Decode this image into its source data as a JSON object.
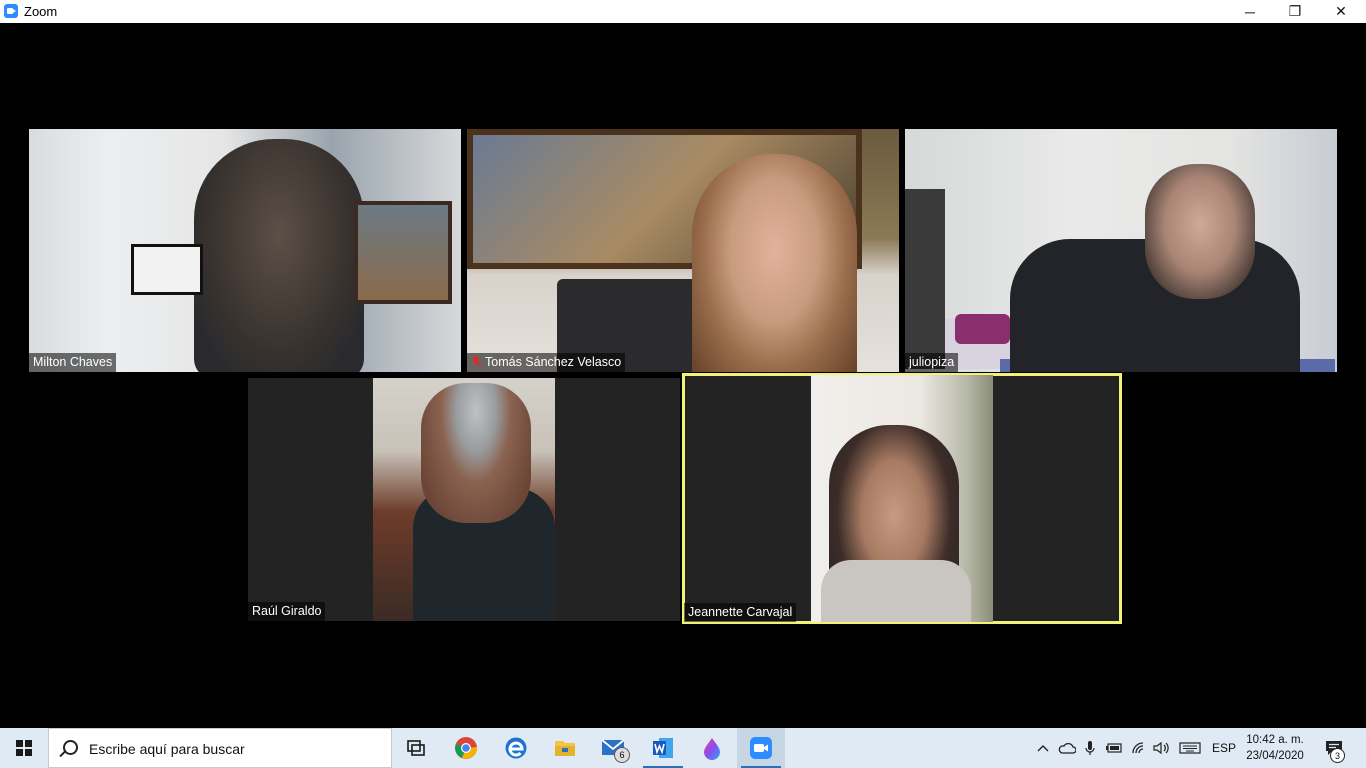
{
  "window": {
    "title": "Zoom",
    "minimize_glyph": "─",
    "restore_glyph": "❐",
    "close_glyph": "✕"
  },
  "participants": [
    {
      "name": "Milton Chaves",
      "muted": false,
      "active_speaker": false
    },
    {
      "name": "Tomás Sánchez Velasco",
      "muted": true,
      "active_speaker": false
    },
    {
      "name": "juliopiza",
      "muted": false,
      "active_speaker": false
    },
    {
      "name": "Raúl Giraldo",
      "muted": false,
      "active_speaker": false
    },
    {
      "name": "Jeannette Carvajal",
      "muted": false,
      "active_speaker": true
    }
  ],
  "taskbar": {
    "search_placeholder": "Escribe aquí para buscar",
    "pinned": [
      {
        "name": "task-view-icon"
      },
      {
        "name": "chrome-icon"
      },
      {
        "name": "edge-icon"
      },
      {
        "name": "file-explorer-icon"
      },
      {
        "name": "mail-icon",
        "badge": "6"
      },
      {
        "name": "word-icon"
      },
      {
        "name": "paint-3d-icon"
      },
      {
        "name": "zoom-icon",
        "active": true
      }
    ],
    "language": "ESP",
    "time": "10:42 a. m.",
    "date": "23/04/2020",
    "notifications": "3"
  }
}
